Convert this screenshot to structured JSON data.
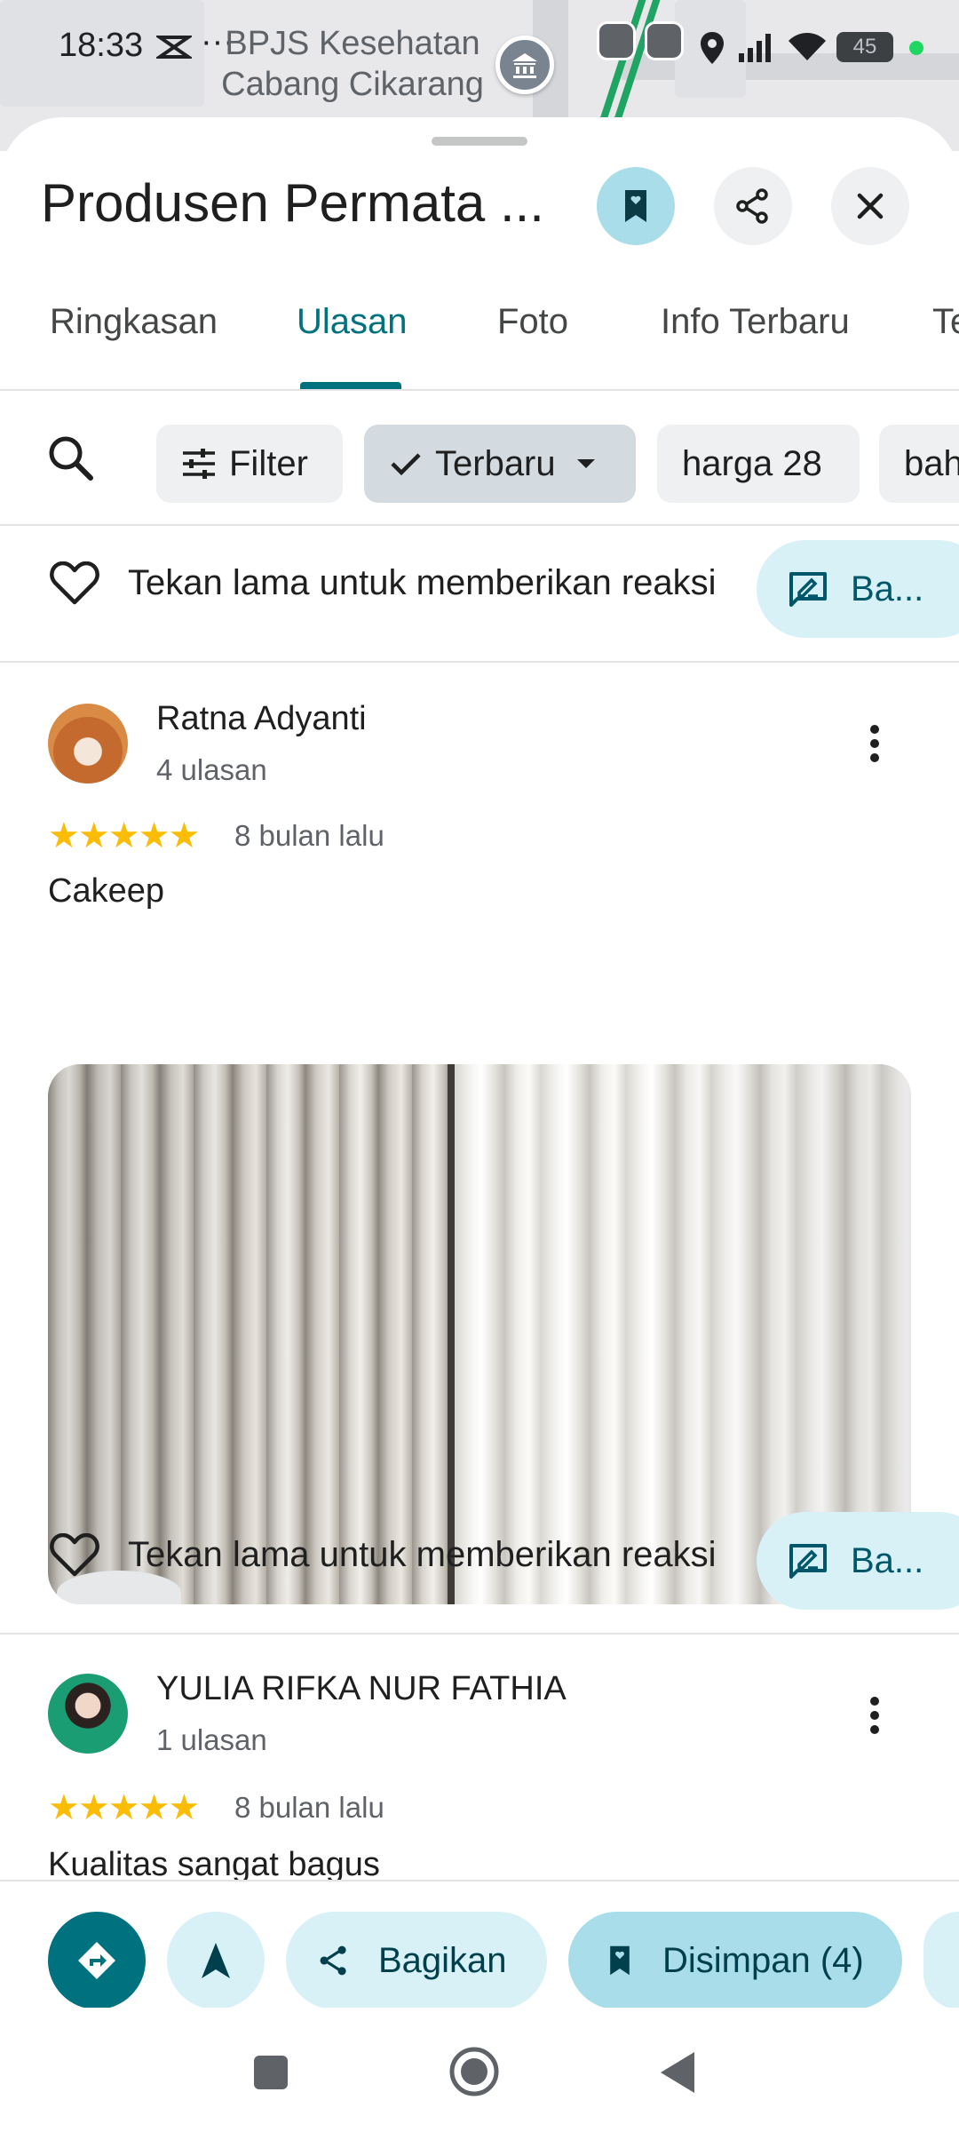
{
  "status_bar": {
    "time": "18:33",
    "battery": "45"
  },
  "map": {
    "label_line1": "BPJS Kesehatan",
    "label_line2": "Cabang Cikarang"
  },
  "place": {
    "title": "Produsen Permata ..."
  },
  "tabs": [
    {
      "label": "Ringkasan"
    },
    {
      "label": "Ulasan"
    },
    {
      "label": "Foto"
    },
    {
      "label": "Info Terbaru"
    },
    {
      "label": "Te"
    }
  ],
  "chips": {
    "filter": "Filter",
    "sort": "Terbaru",
    "topic1": "harga 28",
    "topic2": "bah"
  },
  "reaction": {
    "hint": "Tekan lama untuk memberikan reaksi",
    "share_label": "Ba..."
  },
  "reviews": [
    {
      "name": "Ratna Adyanti",
      "count": "4 ulasan",
      "stars": "★★★★★",
      "time": "8 bulan lalu",
      "text": "Cakeep"
    },
    {
      "name": "YULIA RIFKA NUR FATHIA",
      "count": "1 ulasan",
      "stars": "★★★★★",
      "time": "8 bulan lalu",
      "text": "Kualitas sangat bagus"
    }
  ],
  "bottom_bar": {
    "share": "Bagikan",
    "saved": "Disimpan (4)"
  },
  "colors": {
    "accent": "#00717f",
    "star": "#fbbc04",
    "chip_light": "#d7f1f7",
    "chip_saved": "#a9dde9"
  }
}
